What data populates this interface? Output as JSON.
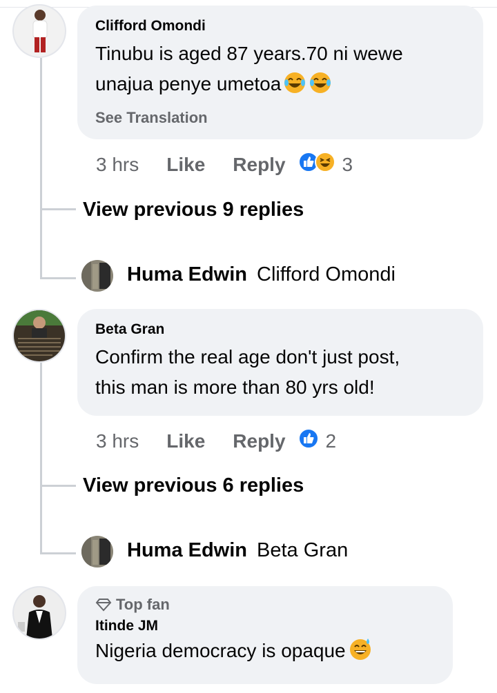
{
  "comments": [
    {
      "author": "Clifford Omondi",
      "text_line1": "Tinubu is aged 87 years.70 ni wewe",
      "text_line2": "unajua penye umetoa",
      "emojis": [
        "tears-of-joy-emoji",
        "tears-of-joy-emoji"
      ],
      "see_translation": "See Translation",
      "time": "3 hrs",
      "like": "Like",
      "reply": "Reply",
      "reactions": [
        "like",
        "haha"
      ],
      "reaction_count": "3",
      "view_previous": "View previous 9 replies",
      "last_reply": {
        "name": "Huma Edwin",
        "text": "Clifford Omondi"
      }
    },
    {
      "author": "Beta Gran",
      "text_line1": "Confirm the real age don't just post,",
      "text_line2": "this man is more than 80 yrs old!",
      "time": "3 hrs",
      "like": "Like",
      "reply": "Reply",
      "reactions": [
        "like"
      ],
      "reaction_count": "2",
      "view_previous": "View previous 6 replies",
      "last_reply": {
        "name": "Huma Edwin",
        "text": "Beta Gran"
      }
    },
    {
      "badge": "Top fan",
      "author": "Itinde JM",
      "text_line1": "Nigeria democracy is opaque",
      "emojis": [
        "grinning-sweat-emoji"
      ]
    }
  ],
  "colors": {
    "bubble": "#f0f2f5",
    "meta": "#65676b",
    "like_blue": "#1877f2",
    "haha_yellow": "#f7b125",
    "thread_line": "#ccd0d5"
  }
}
